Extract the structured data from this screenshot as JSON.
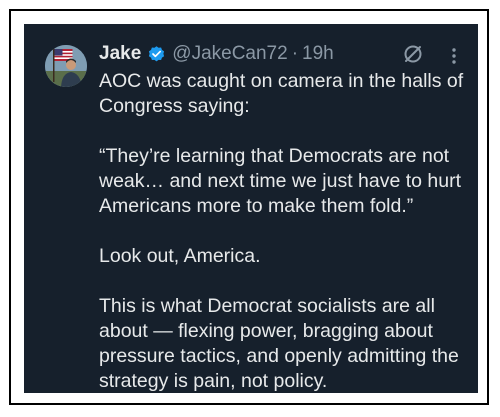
{
  "tweet": {
    "author": {
      "display_name": "Jake",
      "handle": "@JakeCan72",
      "separator": "·",
      "time": "19h",
      "avatar_icon": "avatar-person-with-flag",
      "verified_icon": "verified-badge-icon"
    },
    "paragraphs": [
      "AOC was caught on camera in the halls of Congress saying:",
      "“They’re learning that Democrats are not weak… and next time we just have to hurt Americans more to make them fold.”",
      "Look out, America.",
      "This is what Democrat socialists are all about — flexing power, bragging about pressure tactics, and openly admitting the strategy is pain, not policy."
    ],
    "actions": {
      "grok_icon": "grok-icon",
      "more_icon": "more-options-icon"
    }
  },
  "colors": {
    "background": "#16202c",
    "text_primary": "#e7e9ea",
    "text_secondary": "#8b98a5",
    "verified_blue": "#1d9bf0",
    "frame_border": "#000000"
  }
}
